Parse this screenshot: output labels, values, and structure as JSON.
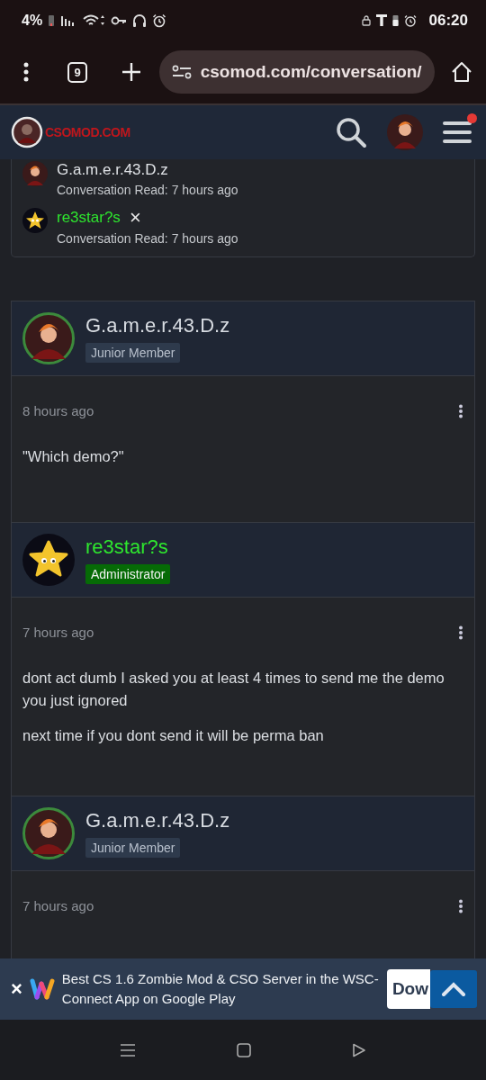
{
  "status_bar": {
    "battery": "4%",
    "time": "06:20"
  },
  "browser": {
    "tab_count": "9",
    "url": "csomod.com/conversation/"
  },
  "site_header": {
    "logo_text": "CSOMOD.COM",
    "notification": true
  },
  "readers": [
    {
      "name": "G.a.m.e.r.43.D.z",
      "kind": "member",
      "status": "Conversation Read: 7 hours ago"
    },
    {
      "name": "re3star?s",
      "kind": "admin",
      "remove": "×",
      "status": "Conversation Read: 7 hours ago"
    }
  ],
  "messages": [
    {
      "author": "G.a.m.e.r.43.D.z",
      "kind": "member",
      "badge": "Junior Member",
      "time": "8 hours ago",
      "paragraphs": [
        "\"Which demo?\""
      ]
    },
    {
      "author": "re3star?s",
      "kind": "admin",
      "badge": "Administrator",
      "time": "7 hours ago",
      "paragraphs": [
        "dont act dumb I asked you at least 4 times to send me the demo you just ignored",
        "next time if you dont send it will be perma ban"
      ]
    },
    {
      "author": "G.a.m.e.r.43.D.z",
      "kind": "member",
      "badge": "Junior Member",
      "time": "7 hours ago"
    }
  ],
  "app_banner": {
    "close": "×",
    "text": "Best CS 1.6 Zombie Mod & CSO Server in the WSC-Connect App on Google Play",
    "button": "Dow"
  }
}
